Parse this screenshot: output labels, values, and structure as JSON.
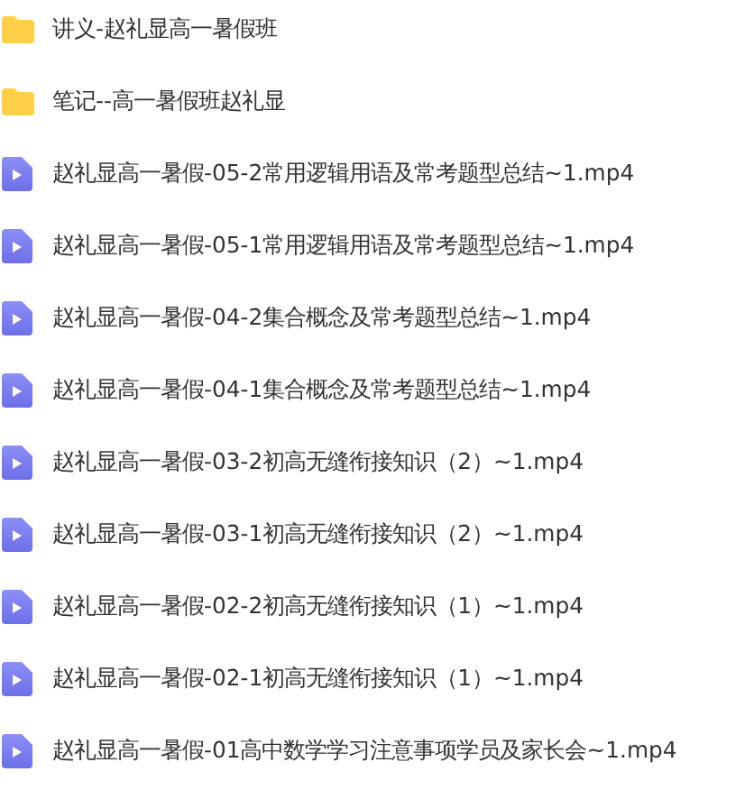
{
  "items": [
    {
      "kind": "folder",
      "name": "讲义-赵礼显高一暑假班"
    },
    {
      "kind": "folder",
      "name": "笔记--高一暑假班赵礼显"
    },
    {
      "kind": "video",
      "name": "赵礼显高一暑假-05-2常用逻辑用语及常考题型总结~1.mp4"
    },
    {
      "kind": "video",
      "name": "赵礼显高一暑假-05-1常用逻辑用语及常考题型总结~1.mp4"
    },
    {
      "kind": "video",
      "name": "赵礼显高一暑假-04-2集合概念及常考题型总结~1.mp4"
    },
    {
      "kind": "video",
      "name": "赵礼显高一暑假-04-1集合概念及常考题型总结~1.mp4"
    },
    {
      "kind": "video",
      "name": "赵礼显高一暑假-03-2初高无缝衔接知识（2）~1.mp4"
    },
    {
      "kind": "video",
      "name": "赵礼显高一暑假-03-1初高无缝衔接知识（2）~1.mp4"
    },
    {
      "kind": "video",
      "name": "赵礼显高一暑假-02-2初高无缝衔接知识（1）~1.mp4"
    },
    {
      "kind": "video",
      "name": "赵礼显高一暑假-02-1初高无缝衔接知识（1）~1.mp4"
    },
    {
      "kind": "video",
      "name": "赵礼显高一暑假-01高中数学学习注意事项学员及家长会~1.mp4"
    }
  ]
}
